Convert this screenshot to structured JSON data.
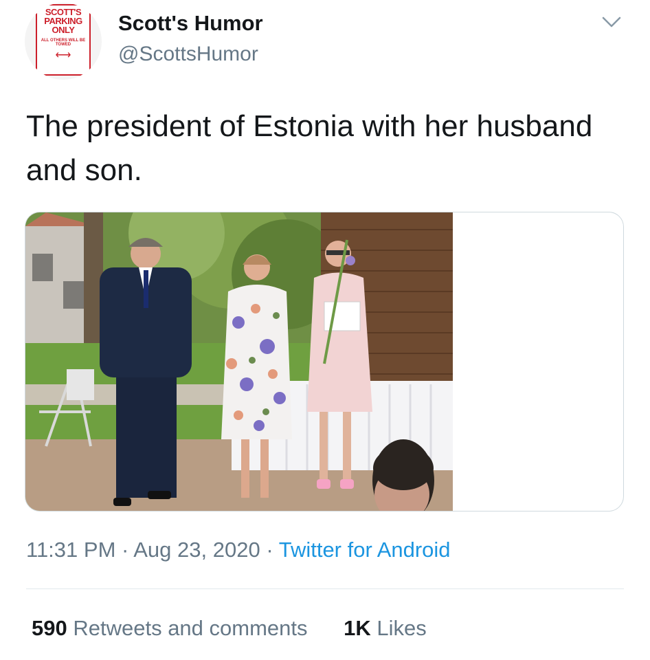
{
  "author": {
    "display_name": "Scott's Humor",
    "handle": "@ScottsHumor",
    "avatar_icon": "parking-sign-avatar",
    "avatar_text": [
      "SCOTT'S",
      "PARKING",
      "ONLY",
      "ALL OTHERS WILL BE TOWED"
    ]
  },
  "menu_icon": "chevron-down-icon",
  "tweet": {
    "text": "The president of Estonia with her husband and son."
  },
  "media": {
    "type": "photo"
  },
  "meta": {
    "time": "11:31 PM",
    "separator": "·",
    "date": "Aug 23, 2020",
    "source": "Twitter for Android"
  },
  "stats": {
    "retweets_count": "590",
    "retweets_label": "Retweets and comments",
    "likes_count": "1K",
    "likes_label": "Likes"
  },
  "colors": {
    "text": "#14171a",
    "secondary": "#657786",
    "link": "#1b95e0",
    "border": "#cfd9de"
  }
}
